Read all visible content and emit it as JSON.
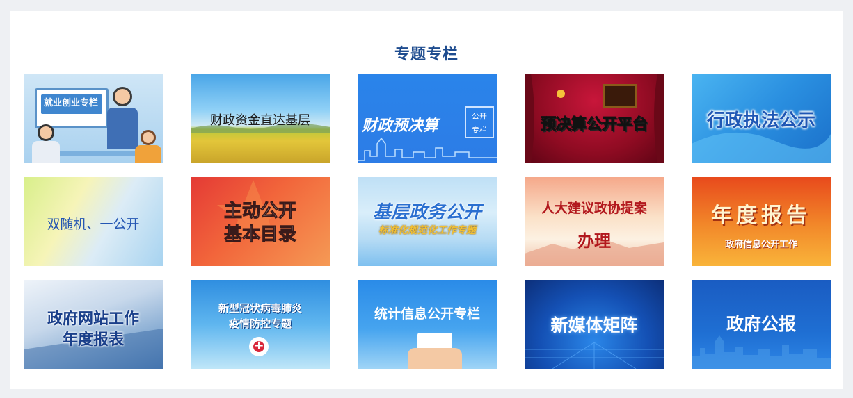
{
  "section": {
    "title": "专题专栏"
  },
  "tiles": [
    {
      "text": "就业创业专栏"
    },
    {
      "text": "财政资金直达基层"
    },
    {
      "text": "财政预决算",
      "badge_line1": "公开",
      "badge_line2": "专栏"
    },
    {
      "text": "预决算公开平台"
    },
    {
      "text": "行政执法公示"
    },
    {
      "text": "双随机、一公开"
    },
    {
      "line1": "主动公开",
      "line2": "基本目录"
    },
    {
      "line1": "基层政务公开",
      "line2": "标准化规范化工作专题"
    },
    {
      "line1": "人大建议政协提案",
      "line2": "办理"
    },
    {
      "line1": "年度报告",
      "line2": "政府信息公开工作"
    },
    {
      "line1": "政府网站工作",
      "line2": "年度报表"
    },
    {
      "line1": "新型冠状病毒肺炎",
      "line2": "疫情防控专题"
    },
    {
      "text": "统计信息公开专栏"
    },
    {
      "text": "新媒体矩阵"
    },
    {
      "text": "政府公报"
    }
  ],
  "colors": {
    "title": "#1e4c8f",
    "page_bg": "#eef0f3",
    "panel_bg": "#ffffff"
  }
}
